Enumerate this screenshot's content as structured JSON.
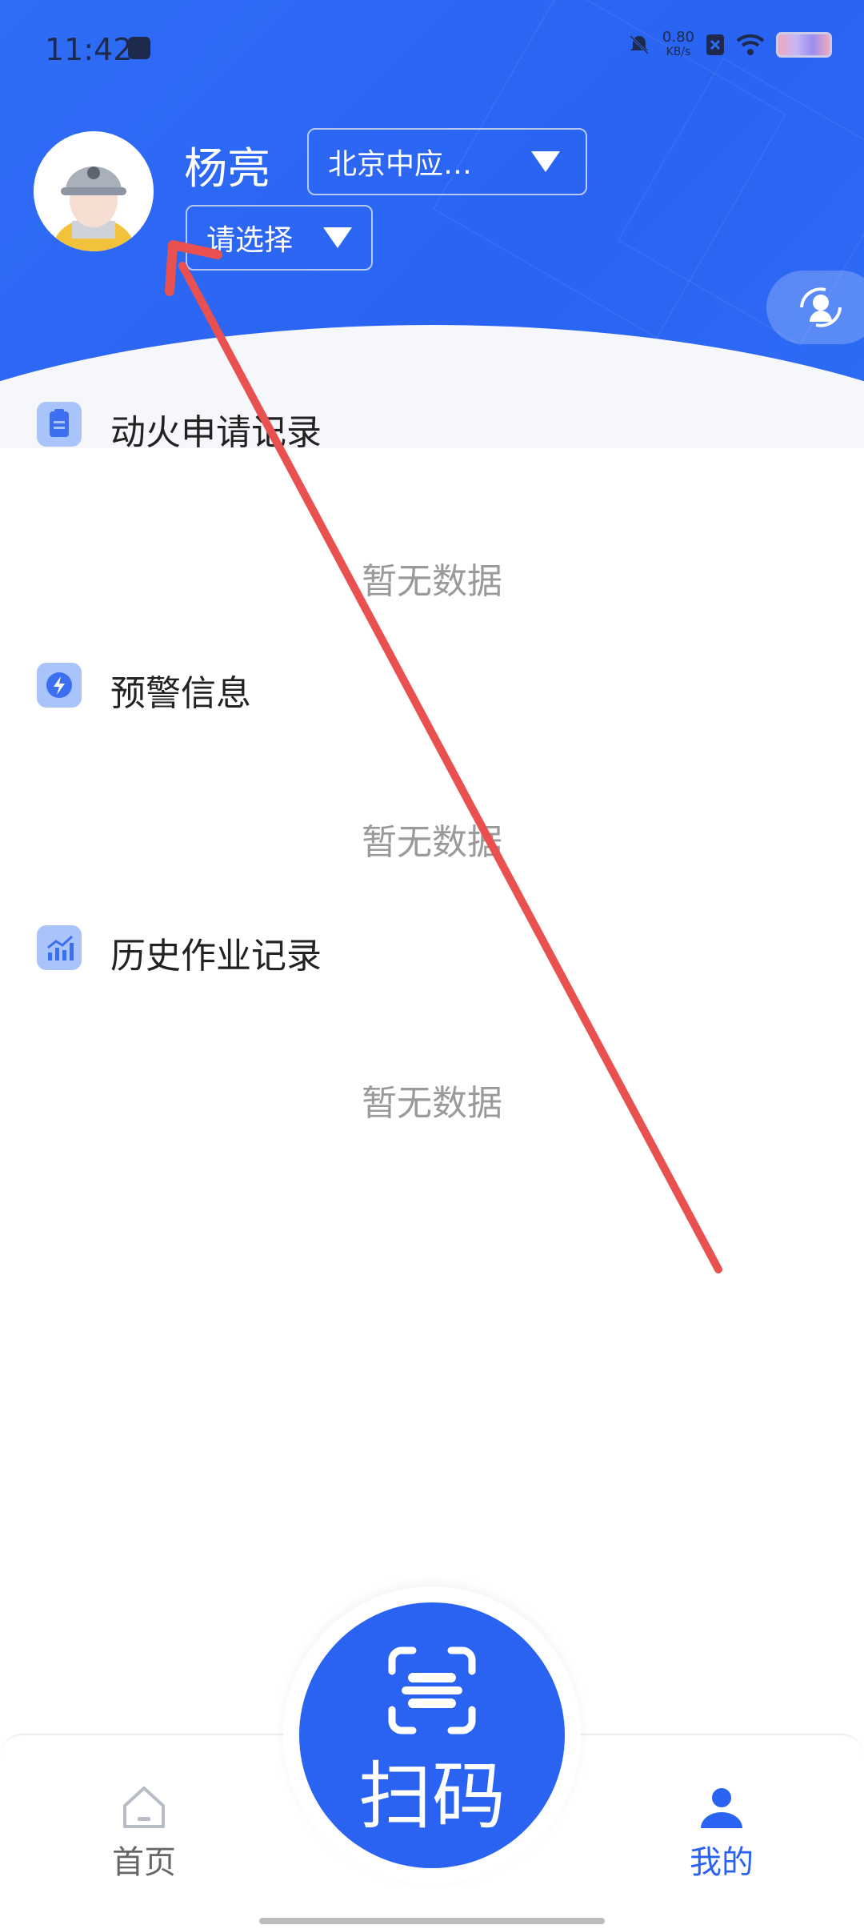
{
  "status_bar": {
    "time": "11:42",
    "net_speed_value": "0.80",
    "net_speed_unit": "KB/s"
  },
  "profile": {
    "name": "杨亮",
    "company_select": "北京中应…",
    "sub_select": "请选择"
  },
  "sections": [
    {
      "title": "动火申请记录",
      "empty_text": "暂无数据",
      "icon": "clipboard-icon"
    },
    {
      "title": "预警信息",
      "empty_text": "暂无数据",
      "icon": "lightning-icon"
    },
    {
      "title": "历史作业记录",
      "empty_text": "暂无数据",
      "icon": "chart-icon"
    }
  ],
  "tabbar": {
    "home_label": "首页",
    "scan_label": "扫码",
    "mine_label": "我的"
  },
  "colors": {
    "primary": "#2a63f2",
    "active_tab": "#2a63f2",
    "inactive_tab": "#666666",
    "annotation_arrow": "#e8514f"
  }
}
